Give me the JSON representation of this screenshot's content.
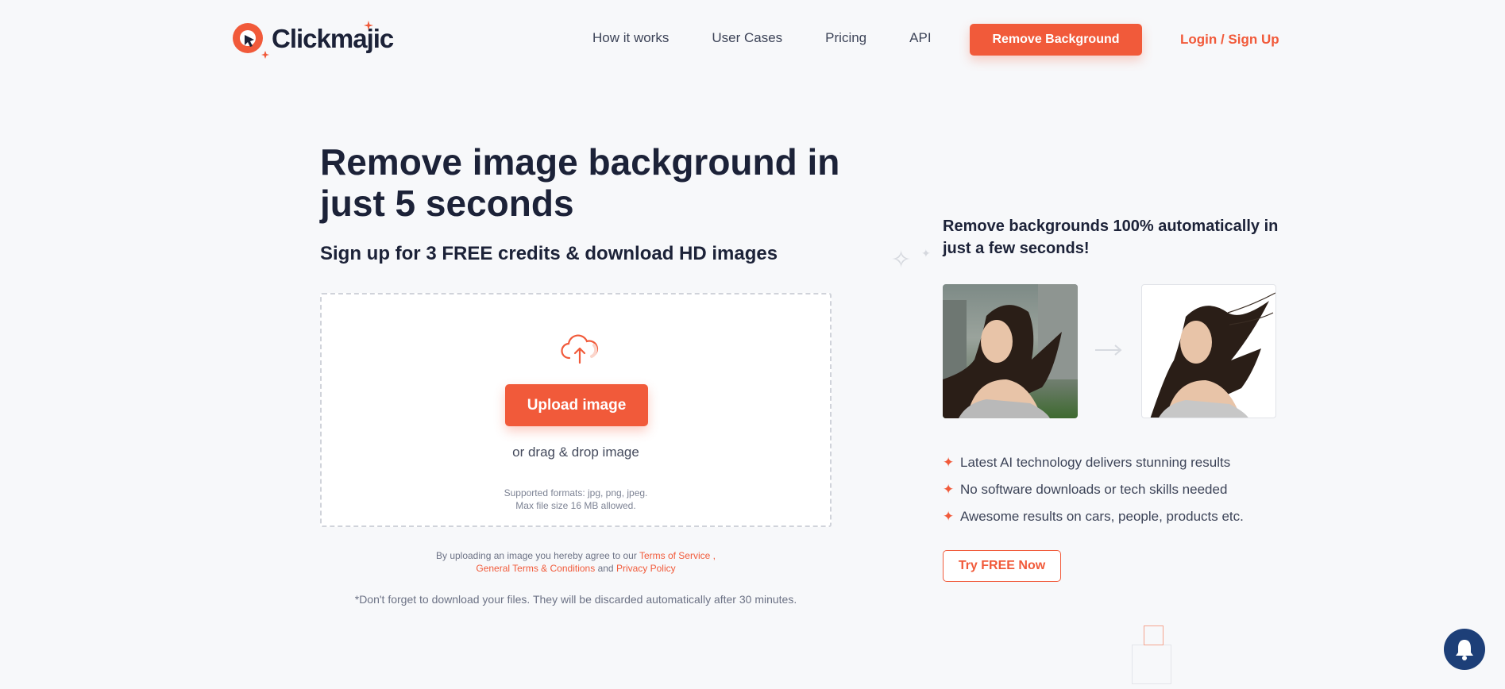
{
  "header": {
    "brand": "Clickmajic",
    "nav": [
      "How it works",
      "User Cases",
      "Pricing",
      "API"
    ],
    "cta_label": "Remove Background",
    "login_label": "Login / Sign Up"
  },
  "hero": {
    "title": "Remove image background in just 5 seconds",
    "subtitle": "Sign up for 3 FREE credits & download HD images",
    "upload": {
      "button_label": "Upload image",
      "drag_text": "or drag & drop image",
      "formats_line1": "Supported formats: jpg, png, jpeg.",
      "formats_line2": "Max file size 16 MB allowed."
    },
    "terms": {
      "prefix": "By uploading an image you hereby agree to our",
      "tos": "Terms of Service",
      "comma": ",",
      "gtc": "General Terms & Conditions",
      "and": "and",
      "privacy": "Privacy Policy"
    },
    "reminder": "*Don't forget to download your files. They will be discarded automatically after 30 minutes."
  },
  "showcase": {
    "title": "Remove backgrounds 100% automatically in just a few seconds!",
    "features": [
      "Latest AI technology delivers stunning results",
      "No software downloads or tech skills needed",
      "Awesome results on cars, people, products etc."
    ],
    "try_label": "Try FREE Now"
  },
  "colors": {
    "accent": "#f15a3a",
    "text_dark": "#1c2238",
    "background": "#f7f8fa",
    "notification": "#1d3f78"
  },
  "icons": {
    "logo": "cursor-circle-logo-icon",
    "upload": "cloud-upload-icon",
    "arrow": "arrow-right-icon",
    "bullet": "sparkle-icon",
    "notification": "bell-icon"
  }
}
